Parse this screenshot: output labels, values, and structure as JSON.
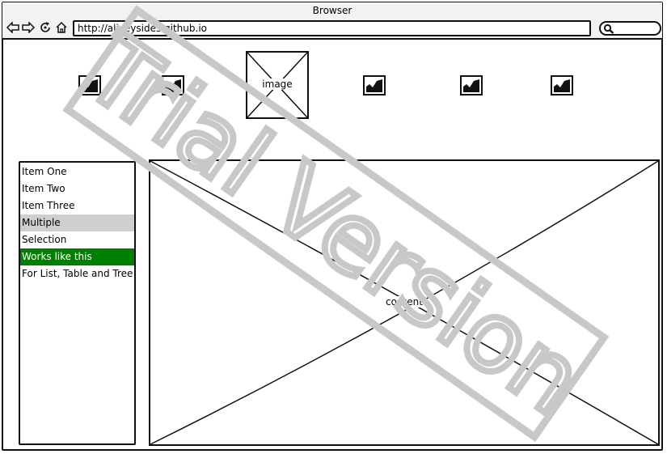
{
  "window": {
    "title": "Browser"
  },
  "toolbar": {
    "url": "http://aliyeysides.github.io",
    "icons": [
      "back-arrow",
      "forward-arrow",
      "reload",
      "home",
      "search"
    ]
  },
  "hero_image": {
    "label": "image"
  },
  "list": {
    "items": [
      {
        "label": "Item One",
        "state": "normal"
      },
      {
        "label": "Item Two",
        "state": "normal"
      },
      {
        "label": "Item Three",
        "state": "normal"
      },
      {
        "label": "Multiple",
        "state": "selected-gray"
      },
      {
        "label": "Selection",
        "state": "normal"
      },
      {
        "label": "Works like this",
        "state": "selected-green"
      },
      {
        "label": "For List, Table and Tree",
        "state": "normal"
      }
    ]
  },
  "content": {
    "label": "content"
  },
  "watermark": {
    "text": "Trial Version"
  },
  "colors": {
    "selection_gray": "#cfcfcf",
    "selection_green": "#008000",
    "watermark": "#cccccc"
  }
}
